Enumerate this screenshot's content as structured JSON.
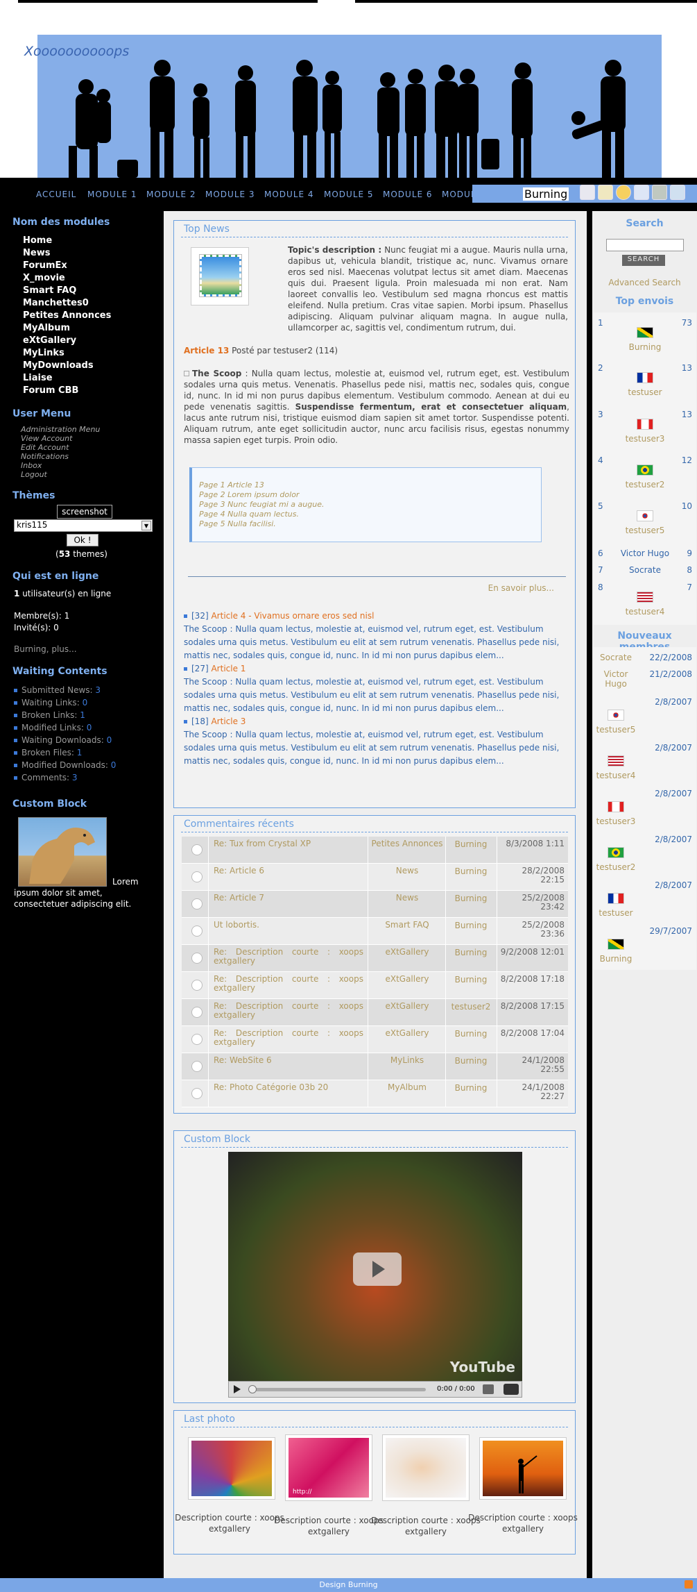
{
  "site": {
    "name": "Xoooooooooops",
    "footer": "Design Burning"
  },
  "nav": {
    "items": [
      "ACCUEIL",
      "MODULE 1",
      "MODULE 2",
      "MODULE 3",
      "MODULE 4",
      "MODULE 5",
      "MODULE 6",
      "MODUL"
    ],
    "user": "Burning"
  },
  "left": {
    "modules_title": "Nom des modules",
    "modules": [
      "Home",
      "News",
      "ForumEx",
      "X_movie",
      "Smart FAQ",
      "Manchettes0",
      "Petites Annonces",
      "MyAlbum",
      "eXtGallery",
      "MyLinks",
      "MyDownloads",
      "Liaise",
      "Forum CBB"
    ],
    "user_menu_title": "User Menu",
    "user_menu": [
      "Administration Menu",
      "View Account",
      "Edit Account",
      "Notifications",
      "Inbox",
      "Logout"
    ],
    "themes_title": "Thèmes",
    "themes_preview": "screenshot",
    "themes_select": "kris115",
    "themes_ok": "Ok !",
    "themes_count": "53",
    "themes_suffix": "themes",
    "online_title": "Qui est en ligne",
    "online_count": "1",
    "online_text": "utilisateur(s) en ligne",
    "members": "Membre(s): 1",
    "guests": "Invité(s): 0",
    "online_list": "Burning, plus...",
    "waiting_title": "Waiting Contents",
    "waiting": [
      {
        "label": "Submitted News:",
        "count": "3"
      },
      {
        "label": "Waiting Links:",
        "count": "0"
      },
      {
        "label": "Broken Links:",
        "count": "1"
      },
      {
        "label": "Modified Links:",
        "count": "0"
      },
      {
        "label": "Waiting Downloads:",
        "count": "0"
      },
      {
        "label": "Broken Files:",
        "count": "1"
      },
      {
        "label": "Modified Downloads:",
        "count": "0"
      },
      {
        "label": "Comments:",
        "count": "3"
      }
    ],
    "custom_title": "Custom Block",
    "custom_text": "Lorem ipsum dolor sit amet, consectetuer adipiscing elit."
  },
  "topnews": {
    "title": "Top News",
    "desc_label": "Topic's description :",
    "desc_text": "Nunc feugiat mi a augue. Mauris nulla urna, dapibus ut, vehicula blandit, tristique ac, nunc. Vivamus ornare eros sed nisl. Maecenas volutpat lectus sit amet diam. Maecenas quis dui. Praesent ligula. Proin malesuada mi non erat. Nam laoreet convallis leo. Vestibulum sed magna rhoncus est mattis eleifend. Nulla pretium. Cras vitae sapien. Morbi ipsum. Phasellus adipiscing. Aliquam pulvinar aliquam magna. In augue nulla, ullamcorper ac, sagittis vel, condimentum rutrum, dui.",
    "article_label": "Article 13",
    "posted_by": "Posté par testuser2 (114)",
    "scoop_label": "The Scoop",
    "scoop_text": ": Nulla quam lectus, molestie at, euismod vel, rutrum eget, est. Vestibulum sodales urna quis metus. Venenatis. Phasellus pede nisi, mattis nec, sodales quis, congue id, nunc. In id mi non purus dapibus elementum. Vestibulum commodo. Aenean at dui eu pede venenatis sagittis.",
    "scoop_bold": "Suspendisse fermentum, erat et consectetuer aliquam",
    "scoop_text2": ", lacus ante rutrum nisi, tristique euismod diam sapien sit amet tortor. Suspendisse potenti. Aliquam rutrum, ante eget sollicitudin auctor, nunc arcu facilisis risus, egestas nonummy massa sapien eget turpis. Proin odio.",
    "pages": [
      "Page 1 Article 13",
      "Page 2 Lorem ipsum dolor",
      "Page 3 Nunc feugiat mi a augue.",
      "Page 4 Nulla quam lectus.",
      "Page 5 Nulla facilisi."
    ],
    "more": "En savoir plus...",
    "list": [
      {
        "num": "[32]",
        "title": "Article 4 - Vivamus ornare eros sed nisl",
        "text": "The Scoop : Nulla quam lectus, molestie at, euismod vel, rutrum eget, est. Vestibulum sodales urna quis metus. Vestibulum eu elit at sem rutrum venenatis. Phasellus pede nisi, mattis nec, sodales quis, congue id, nunc. In id mi non purus dapibus elem..."
      },
      {
        "num": "[27]",
        "title": "Article 1",
        "text": "The Scoop : Nulla quam lectus, molestie at, euismod vel, rutrum eget, est. Vestibulum sodales urna quis metus. Vestibulum eu elit at sem rutrum venenatis. Phasellus pede nisi, mattis nec, sodales quis, congue id, nunc. In id mi non purus dapibus elem..."
      },
      {
        "num": "[18]",
        "title": "Article 3",
        "text": "The Scoop : Nulla quam lectus, molestie at, euismod vel, rutrum eget, est. Vestibulum sodales urna quis metus. Vestibulum eu elit at sem rutrum venenatis. Phasellus pede nisi, mattis nec, sodales quis, congue id, nunc. In id mi non purus dapibus elem..."
      }
    ]
  },
  "comments": {
    "title": "Commentaires récents",
    "rows": [
      {
        "subject": "Re: Tux from Crystal XP",
        "module": "Petites Annonces",
        "user": "Burning",
        "date": "8/3/2008 1:11"
      },
      {
        "subject": "Re: Article 6",
        "module": "News",
        "user": "Burning",
        "date": "28/2/2008 22:15"
      },
      {
        "subject": "Re: Article 7",
        "module": "News",
        "user": "Burning",
        "date": "25/2/2008 23:42"
      },
      {
        "subject": "Ut lobortis.",
        "module": "Smart FAQ",
        "user": "Burning",
        "date": "25/2/2008 23:36"
      },
      {
        "subject": "Re: Description courte : xoops extgallery",
        "module": "eXtGallery",
        "user": "Burning",
        "date": "9/2/2008 12:01"
      },
      {
        "subject": "Re: Description courte : xoops extgallery",
        "module": "eXtGallery",
        "user": "Burning",
        "date": "8/2/2008 17:18"
      },
      {
        "subject": "Re: Description courte : xoops extgallery",
        "module": "eXtGallery",
        "user": "testuser2",
        "date": "8/2/2008 17:15"
      },
      {
        "subject": "Re: Description courte : xoops extgallery",
        "module": "eXtGallery",
        "user": "Burning",
        "date": "8/2/2008 17:04"
      },
      {
        "subject": "Re: WebSite 6",
        "module": "MyLinks",
        "user": "Burning",
        "date": "24/1/2008 22:55"
      },
      {
        "subject": "Re: Photo Catégorie 03b 20",
        "module": "MyAlbum",
        "user": "Burning",
        "date": "24/1/2008 22:27"
      }
    ]
  },
  "video": {
    "title": "Custom Block",
    "time": "0:00 / 0:00",
    "brand": "YouTube"
  },
  "photos": {
    "title": "Last photo",
    "items": [
      {
        "caption": "Description courte : xoops extgallery"
      },
      {
        "caption": "Description courte : xoops extgallery",
        "overlay": "http://"
      },
      {
        "caption": "Description courte : xoops extgallery"
      },
      {
        "caption": "Description courte : xoops extgallery"
      }
    ]
  },
  "right": {
    "search_title": "Search",
    "search_button": "Search",
    "advanced": "Advanced Search",
    "top_title": "Top envois",
    "top": [
      {
        "rank": "1",
        "name": "Burning",
        "count": "73",
        "flag": "jm"
      },
      {
        "rank": "2",
        "name": "testuser",
        "count": "13",
        "flag": "fr"
      },
      {
        "rank": "3",
        "name": "testuser3",
        "count": "13",
        "flag": "ca"
      },
      {
        "rank": "4",
        "name": "testuser2",
        "count": "12",
        "flag": "br"
      },
      {
        "rank": "5",
        "name": "testuser5",
        "count": "10",
        "flag": "kr"
      },
      {
        "rank": "6",
        "name": "Victor Hugo",
        "count": "9",
        "flag": ""
      },
      {
        "rank": "7",
        "name": "Socrate",
        "count": "8",
        "flag": ""
      },
      {
        "rank": "8",
        "name": "testuser4",
        "count": "7",
        "flag": "us"
      }
    ],
    "new_title": "Nouveaux membres",
    "new_members": [
      {
        "name": "Socrate",
        "date": "22/2/2008",
        "flag": ""
      },
      {
        "name": "Victor Hugo",
        "date": "21/2/2008",
        "flag": ""
      },
      {
        "name": "testuser5",
        "date": "2/8/2007",
        "flag": "kr"
      },
      {
        "name": "testuser4",
        "date": "2/8/2007",
        "flag": "us"
      },
      {
        "name": "testuser3",
        "date": "2/8/2007",
        "flag": "ca"
      },
      {
        "name": "testuser2",
        "date": "2/8/2007",
        "flag": "br"
      },
      {
        "name": "testuser",
        "date": "2/8/2007",
        "flag": "fr"
      },
      {
        "name": "Burning",
        "date": "29/7/2007",
        "flag": "jm"
      }
    ]
  }
}
